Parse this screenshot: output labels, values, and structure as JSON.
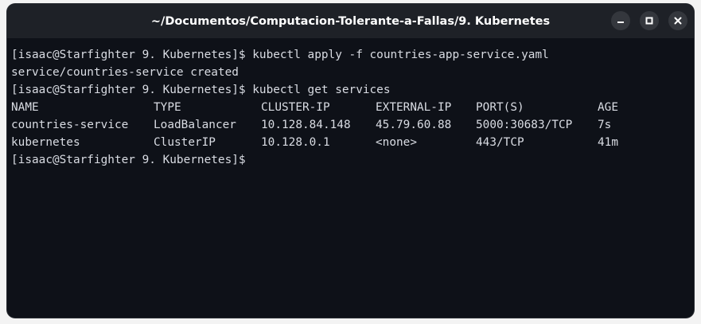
{
  "window": {
    "title": "~/Documentos/Computacion-Tolerante-a-Fallas/9. Kubernetes"
  },
  "controls": {
    "minimize_icon": "minimize-icon",
    "maximize_icon": "maximize-icon",
    "close_icon": "close-icon"
  },
  "terminal": {
    "lines": [
      "[isaac@Starfighter 9. Kubernetes]$ kubectl apply -f countries-app-service.yaml",
      "service/countries-service created",
      "[isaac@Starfighter 9. Kubernetes]$ kubectl get services"
    ],
    "table": {
      "headers": [
        "NAME",
        "TYPE",
        "CLUSTER-IP",
        "EXTERNAL-IP",
        "PORT(S)",
        "AGE"
      ],
      "rows": [
        [
          "countries-service",
          "LoadBalancer",
          "10.128.84.148",
          "45.79.60.88",
          "5000:30683/TCP",
          "7s"
        ],
        [
          "kubernetes",
          "ClusterIP",
          "10.128.0.1",
          "<none>",
          "443/TCP",
          "41m"
        ]
      ]
    },
    "prompt": "[isaac@Starfighter 9. Kubernetes]$"
  }
}
